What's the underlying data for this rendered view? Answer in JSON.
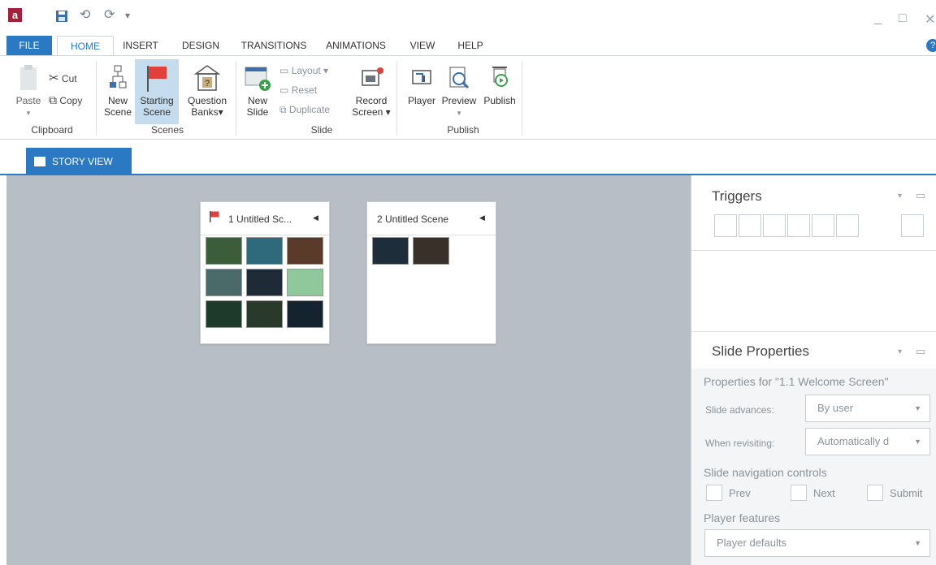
{
  "quick_access": {
    "undo": "⟲",
    "redo": "⟳",
    "customize": "▾"
  },
  "tabs": [
    "FILE",
    "HOME",
    "INSERT",
    "DESIGN",
    "TRANSITIONS",
    "ANIMATIONS",
    "VIEW",
    "HELP"
  ],
  "ribbon": {
    "clipboard": {
      "paste": "Paste",
      "cut": "Cut",
      "copy": "Copy",
      "group": "Clipboard"
    },
    "scenes": {
      "new_scene_1": "New",
      "new_scene_2": "Scene",
      "starting_1": "Starting",
      "starting_2": "Scene",
      "qbanks_1": "Question",
      "qbanks_2": "Banks▾",
      "group": "Scenes"
    },
    "slide": {
      "new_slide_1": "New",
      "new_slide_2": "Slide",
      "layout": "Layout ▾",
      "reset": "Reset",
      "duplicate": "Duplicate",
      "record_1": "Record",
      "record_2": "Screen ▾",
      "group": "Slide"
    },
    "publish": {
      "player": "Player",
      "preview": "Preview",
      "publish": "Publish",
      "group": "Publish"
    }
  },
  "story_view_tab": "STORY VIEW",
  "scenes": [
    {
      "title": "1 Untitled Sc...",
      "thumbs": [
        "#3b5d3a",
        "#2f6a7c",
        "#5a3a28",
        "#4a6a6a",
        "#1e2a36",
        "#8fc89a",
        "#1d3a2a",
        "#2a3a2a",
        "#15232f"
      ]
    },
    {
      "title": "2 Untitled Scene",
      "thumbs": [
        "#1e2d3a",
        "#3a302a"
      ]
    }
  ],
  "triggers": {
    "title": "Triggers"
  },
  "slide_properties": {
    "title": "Slide Properties",
    "properties_for": "Properties for \"1.1 Welcome Screen\"",
    "slide_advances_label": "Slide advances:",
    "slide_advances_value": "By user",
    "when_revisiting_label": "When revisiting:",
    "when_revisiting_value": "Automatically d",
    "nav_controls_label": "Slide navigation controls",
    "prev": "Prev",
    "next": "Next",
    "submit": "Submit",
    "player_features_label": "Player features",
    "player_features_value": "Player defaults"
  },
  "colors": {
    "accent": "#2b79c2",
    "canvas": "#b7bec6",
    "flag": "#e2403a"
  }
}
